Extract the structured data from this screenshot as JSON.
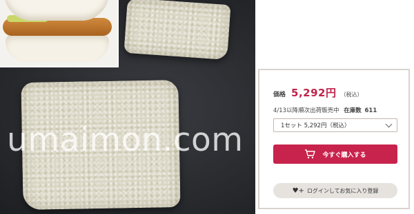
{
  "watermark": "umaimon.com",
  "product": {
    "price_label": "価格",
    "price": "5,292円",
    "price_tax": "（税込）",
    "availability": "4/13以降順次出荷販売中",
    "stock_label": "在庫数",
    "stock_count": "611",
    "option_selected": "1セット 5,292円（税込）",
    "buy_label": "今すぐ購入する",
    "wishlist_label": "ログインしてお気に入り登録"
  },
  "icons": {
    "cart": "cart-icon",
    "heart": "heart-plus-icon",
    "chevron": "chevron-down-icon"
  },
  "colors": {
    "accent": "#c8234d",
    "price": "#c0224a",
    "wishlist_bg": "#e6e3df"
  }
}
